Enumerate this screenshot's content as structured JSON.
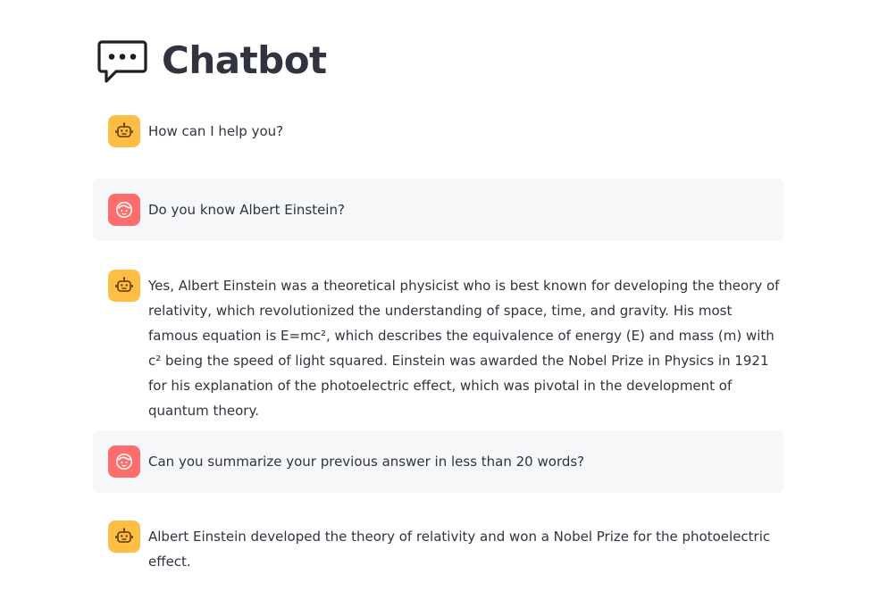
{
  "header": {
    "title": "Chatbot",
    "icon": "speech-bubble-icon"
  },
  "colors": {
    "assistant_avatar": "#ffbd45",
    "user_avatar": "#ff6c6c",
    "user_message_bg": "#f6f7f9",
    "text": "#31333f"
  },
  "messages": [
    {
      "role": "assistant",
      "avatar_icon": "robot-icon",
      "text": "How can I help you?"
    },
    {
      "role": "user",
      "avatar_icon": "user-face-icon",
      "text": "Do you know Albert Einstein?"
    },
    {
      "role": "assistant",
      "avatar_icon": "robot-icon",
      "text": "Yes, Albert Einstein was a theoretical physicist who is best known for developing the theory of relativity, which revolutionized the understanding of space, time, and gravity. His most famous equation is E=mc², which describes the equivalence of energy (E) and mass (m) with c² being the speed of light squared. Einstein was awarded the Nobel Prize in Physics in 1921 for his explanation of the photoelectric effect, which was pivotal in the development of quantum theory."
    },
    {
      "role": "user",
      "avatar_icon": "user-face-icon",
      "text": "Can you summarize your previous answer in less than 20 words?"
    },
    {
      "role": "assistant",
      "avatar_icon": "robot-icon",
      "text": "Albert Einstein developed the theory of relativity and won a Nobel Prize for the photoelectric effect."
    }
  ]
}
